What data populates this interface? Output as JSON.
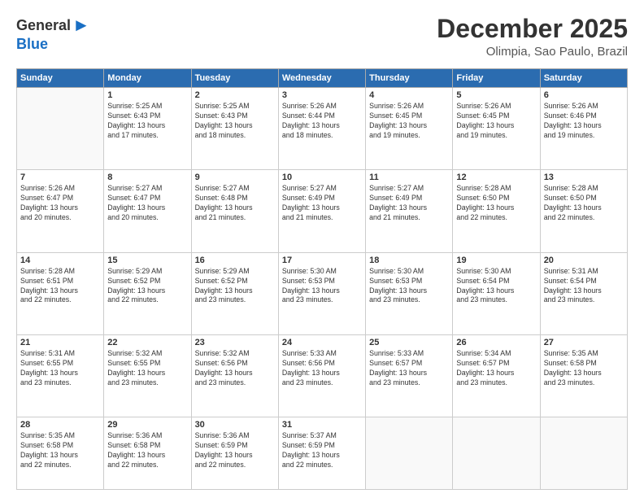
{
  "logo": {
    "general": "General",
    "blue": "Blue"
  },
  "title": "December 2025",
  "subtitle": "Olimpia, Sao Paulo, Brazil",
  "days_header": [
    "Sunday",
    "Monday",
    "Tuesday",
    "Wednesday",
    "Thursday",
    "Friday",
    "Saturday"
  ],
  "weeks": [
    [
      {
        "day": "",
        "info": ""
      },
      {
        "day": "1",
        "info": "Sunrise: 5:25 AM\nSunset: 6:43 PM\nDaylight: 13 hours\nand 17 minutes."
      },
      {
        "day": "2",
        "info": "Sunrise: 5:25 AM\nSunset: 6:43 PM\nDaylight: 13 hours\nand 18 minutes."
      },
      {
        "day": "3",
        "info": "Sunrise: 5:26 AM\nSunset: 6:44 PM\nDaylight: 13 hours\nand 18 minutes."
      },
      {
        "day": "4",
        "info": "Sunrise: 5:26 AM\nSunset: 6:45 PM\nDaylight: 13 hours\nand 19 minutes."
      },
      {
        "day": "5",
        "info": "Sunrise: 5:26 AM\nSunset: 6:45 PM\nDaylight: 13 hours\nand 19 minutes."
      },
      {
        "day": "6",
        "info": "Sunrise: 5:26 AM\nSunset: 6:46 PM\nDaylight: 13 hours\nand 19 minutes."
      }
    ],
    [
      {
        "day": "7",
        "info": "Sunrise: 5:26 AM\nSunset: 6:47 PM\nDaylight: 13 hours\nand 20 minutes."
      },
      {
        "day": "8",
        "info": "Sunrise: 5:27 AM\nSunset: 6:47 PM\nDaylight: 13 hours\nand 20 minutes."
      },
      {
        "day": "9",
        "info": "Sunrise: 5:27 AM\nSunset: 6:48 PM\nDaylight: 13 hours\nand 21 minutes."
      },
      {
        "day": "10",
        "info": "Sunrise: 5:27 AM\nSunset: 6:49 PM\nDaylight: 13 hours\nand 21 minutes."
      },
      {
        "day": "11",
        "info": "Sunrise: 5:27 AM\nSunset: 6:49 PM\nDaylight: 13 hours\nand 21 minutes."
      },
      {
        "day": "12",
        "info": "Sunrise: 5:28 AM\nSunset: 6:50 PM\nDaylight: 13 hours\nand 22 minutes."
      },
      {
        "day": "13",
        "info": "Sunrise: 5:28 AM\nSunset: 6:50 PM\nDaylight: 13 hours\nand 22 minutes."
      }
    ],
    [
      {
        "day": "14",
        "info": "Sunrise: 5:28 AM\nSunset: 6:51 PM\nDaylight: 13 hours\nand 22 minutes."
      },
      {
        "day": "15",
        "info": "Sunrise: 5:29 AM\nSunset: 6:52 PM\nDaylight: 13 hours\nand 22 minutes."
      },
      {
        "day": "16",
        "info": "Sunrise: 5:29 AM\nSunset: 6:52 PM\nDaylight: 13 hours\nand 23 minutes."
      },
      {
        "day": "17",
        "info": "Sunrise: 5:30 AM\nSunset: 6:53 PM\nDaylight: 13 hours\nand 23 minutes."
      },
      {
        "day": "18",
        "info": "Sunrise: 5:30 AM\nSunset: 6:53 PM\nDaylight: 13 hours\nand 23 minutes."
      },
      {
        "day": "19",
        "info": "Sunrise: 5:30 AM\nSunset: 6:54 PM\nDaylight: 13 hours\nand 23 minutes."
      },
      {
        "day": "20",
        "info": "Sunrise: 5:31 AM\nSunset: 6:54 PM\nDaylight: 13 hours\nand 23 minutes."
      }
    ],
    [
      {
        "day": "21",
        "info": "Sunrise: 5:31 AM\nSunset: 6:55 PM\nDaylight: 13 hours\nand 23 minutes."
      },
      {
        "day": "22",
        "info": "Sunrise: 5:32 AM\nSunset: 6:55 PM\nDaylight: 13 hours\nand 23 minutes."
      },
      {
        "day": "23",
        "info": "Sunrise: 5:32 AM\nSunset: 6:56 PM\nDaylight: 13 hours\nand 23 minutes."
      },
      {
        "day": "24",
        "info": "Sunrise: 5:33 AM\nSunset: 6:56 PM\nDaylight: 13 hours\nand 23 minutes."
      },
      {
        "day": "25",
        "info": "Sunrise: 5:33 AM\nSunset: 6:57 PM\nDaylight: 13 hours\nand 23 minutes."
      },
      {
        "day": "26",
        "info": "Sunrise: 5:34 AM\nSunset: 6:57 PM\nDaylight: 13 hours\nand 23 minutes."
      },
      {
        "day": "27",
        "info": "Sunrise: 5:35 AM\nSunset: 6:58 PM\nDaylight: 13 hours\nand 23 minutes."
      }
    ],
    [
      {
        "day": "28",
        "info": "Sunrise: 5:35 AM\nSunset: 6:58 PM\nDaylight: 13 hours\nand 22 minutes."
      },
      {
        "day": "29",
        "info": "Sunrise: 5:36 AM\nSunset: 6:58 PM\nDaylight: 13 hours\nand 22 minutes."
      },
      {
        "day": "30",
        "info": "Sunrise: 5:36 AM\nSunset: 6:59 PM\nDaylight: 13 hours\nand 22 minutes."
      },
      {
        "day": "31",
        "info": "Sunrise: 5:37 AM\nSunset: 6:59 PM\nDaylight: 13 hours\nand 22 minutes."
      },
      {
        "day": "",
        "info": ""
      },
      {
        "day": "",
        "info": ""
      },
      {
        "day": "",
        "info": ""
      }
    ]
  ]
}
